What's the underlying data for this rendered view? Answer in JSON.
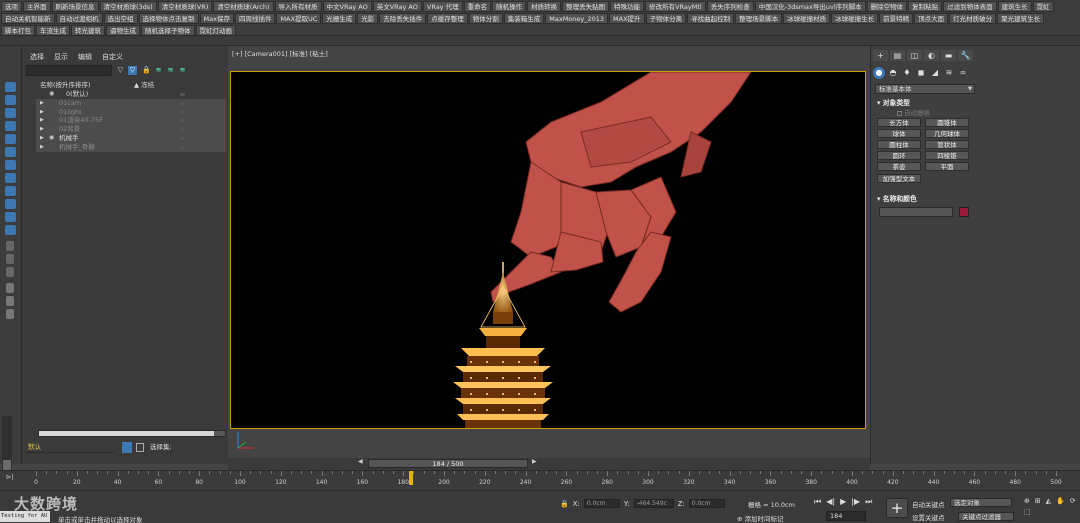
{
  "scriptbar": {
    "buttons": [
      "选项",
      "主界面",
      "刷新场景信息",
      "清空材质球(3ds)",
      "清空材质球(VR)",
      "清空材质球(Arch)",
      "导入所有材质",
      "中文VRay AO",
      "英文VRay AO",
      "VRay 代理",
      "重命名",
      "随机操作",
      "材质转换",
      "整理丢失贴图",
      "特殊功能",
      "修改所有VRayMtl",
      "丢失序列检查",
      "中国汉化-3dsmax导出uvl序列脚本",
      "删除空物体",
      "复制粘贴",
      "过滤到物体表面",
      "建筑生长",
      "霓虹",
      "自动关机智能新",
      "自动过渡相机",
      "选出空组",
      "选择物体点击复制",
      "Max保存",
      "四周线插件",
      "MAX提取UC",
      "光栅生成",
      "光影",
      "去除丢失插件",
      "点缓存整理",
      "物体分割",
      "集装箱生成",
      "MaxMoney_2013",
      "MAX提升",
      "子物体分离",
      "寻找曲起控制",
      "整理场景脚本",
      "冰球碰撞材质",
      "冰球碰撞生长",
      "前景特精",
      "顶点大面",
      "灯光材质破分",
      "聚光建筑生长",
      "脚本打包",
      "车流生成",
      "转光建筑",
      "逼物生成",
      "随机选择子物体",
      "霓虹灯动画"
    ]
  },
  "explorer": {
    "menu": [
      "选择",
      "显示",
      "编辑",
      "自定义"
    ],
    "header_name": "名称(按升序排序)",
    "header_freeze": "▲ 冻结",
    "rows": [
      {
        "label": "0(默认)",
        "dim": false,
        "hl": false
      },
      {
        "label": "01cam",
        "dim": true,
        "hl": true
      },
      {
        "label": "01light",
        "dim": true,
        "hl": true
      },
      {
        "label": "01渲染40-75F",
        "dim": true,
        "hl": true
      },
      {
        "label": "02背景",
        "dim": true,
        "hl": true
      },
      {
        "label": "机械手",
        "dim": false,
        "hl": true
      },
      {
        "label": "机械手_骨骼",
        "dim": true,
        "hl": true
      }
    ],
    "layer_value": "默认",
    "layer_label": "选择集:"
  },
  "viewport": {
    "label": "[+] [Camera001] [标准] [粘土]"
  },
  "command_panel": {
    "tabs": [
      "+",
      "▤",
      "◫",
      "◐",
      "▬",
      "🔧"
    ],
    "subtabs": [
      "●",
      "◓",
      "♦",
      "◼",
      "◢",
      "≋",
      "∞"
    ],
    "primitive_type": "标准基本体",
    "object_type_title": "对象类型",
    "autogrid": "自动栅格",
    "objects": [
      "长方体",
      "圆锥体",
      "球体",
      "几何球体",
      "圆柱体",
      "管状体",
      "圆环",
      "四棱锥",
      "茶壶",
      "平面"
    ],
    "extra": "加强型文本",
    "name_color_title": "名称和颜色",
    "color": "#9a1a3a"
  },
  "timeline": {
    "frame_display": "184 / 500",
    "ticks": [
      "0",
      "20",
      "40",
      "60",
      "80",
      "100",
      "120",
      "140",
      "160",
      "180",
      "200",
      "220",
      "240",
      "260",
      "280",
      "300",
      "320",
      "340",
      "360",
      "380",
      "400",
      "420",
      "440",
      "460",
      "480",
      "500"
    ],
    "playhead_frame": 184
  },
  "status": {
    "logo": "大数跨境",
    "testing": "Testing for AU",
    "hint": "单击或单击并拖动以选择对象",
    "x_value": "0.0cm",
    "y_value": "-464.549c",
    "z_value": "0.0cm",
    "grid": "栅格 = 10.0cm",
    "add_time_tag": "添加时间标记",
    "frame_value": "184",
    "auto_key": "自动关键点",
    "set_key": "设置关键点",
    "selected_obj": "选定对象",
    "key_filter": "关键点过滤器"
  }
}
